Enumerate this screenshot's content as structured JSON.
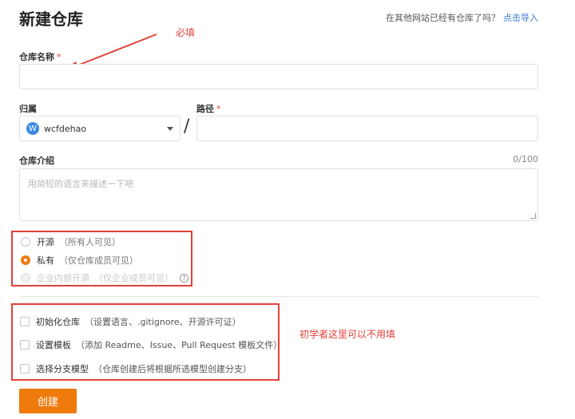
{
  "header": {
    "title": "新建仓库",
    "import_hint": "在其他网站已经有仓库了吗？",
    "import_link": "点击导入"
  },
  "annotations": {
    "required_hint": "必填",
    "beginner_hint": "初学者这里可以不用填"
  },
  "form": {
    "repo_name": {
      "label": "仓库名称",
      "required_mark": "*",
      "value": ""
    },
    "owner": {
      "label": "归属",
      "avatar_letter": "W",
      "value": "wcfdehao"
    },
    "path_separator": "/",
    "path": {
      "label": "路径",
      "required_mark": "*",
      "value": ""
    },
    "description": {
      "label": "仓库介绍",
      "counter": "0/100",
      "placeholder": "用简短的语言来描述一下吧"
    },
    "visibility": [
      {
        "label": "开源",
        "sub": "（所有人可见）",
        "checked": false,
        "disabled": false
      },
      {
        "label": "私有",
        "sub": "（仅仓库成员可见）",
        "checked": true,
        "disabled": false
      },
      {
        "label": "企业内部开源",
        "sub": "（仅企业成员可见）",
        "checked": false,
        "disabled": true,
        "help_icon": "?"
      }
    ],
    "options": [
      {
        "label": "初始化仓库",
        "sub": "（设置语言、.gitignore、开源许可证）",
        "checked": false
      },
      {
        "label": "设置模板",
        "sub": "（添加 Readme、Issue、Pull Request 模板文件）",
        "checked": false
      },
      {
        "label": "选择分支模型",
        "sub": "（仓库创建后将根据所选模型创建分支）",
        "checked": false
      }
    ],
    "submit_label": "创建"
  },
  "colors": {
    "accent": "#f07b0d",
    "annotation_red": "#e2403a",
    "link": "#3a7bd5"
  }
}
